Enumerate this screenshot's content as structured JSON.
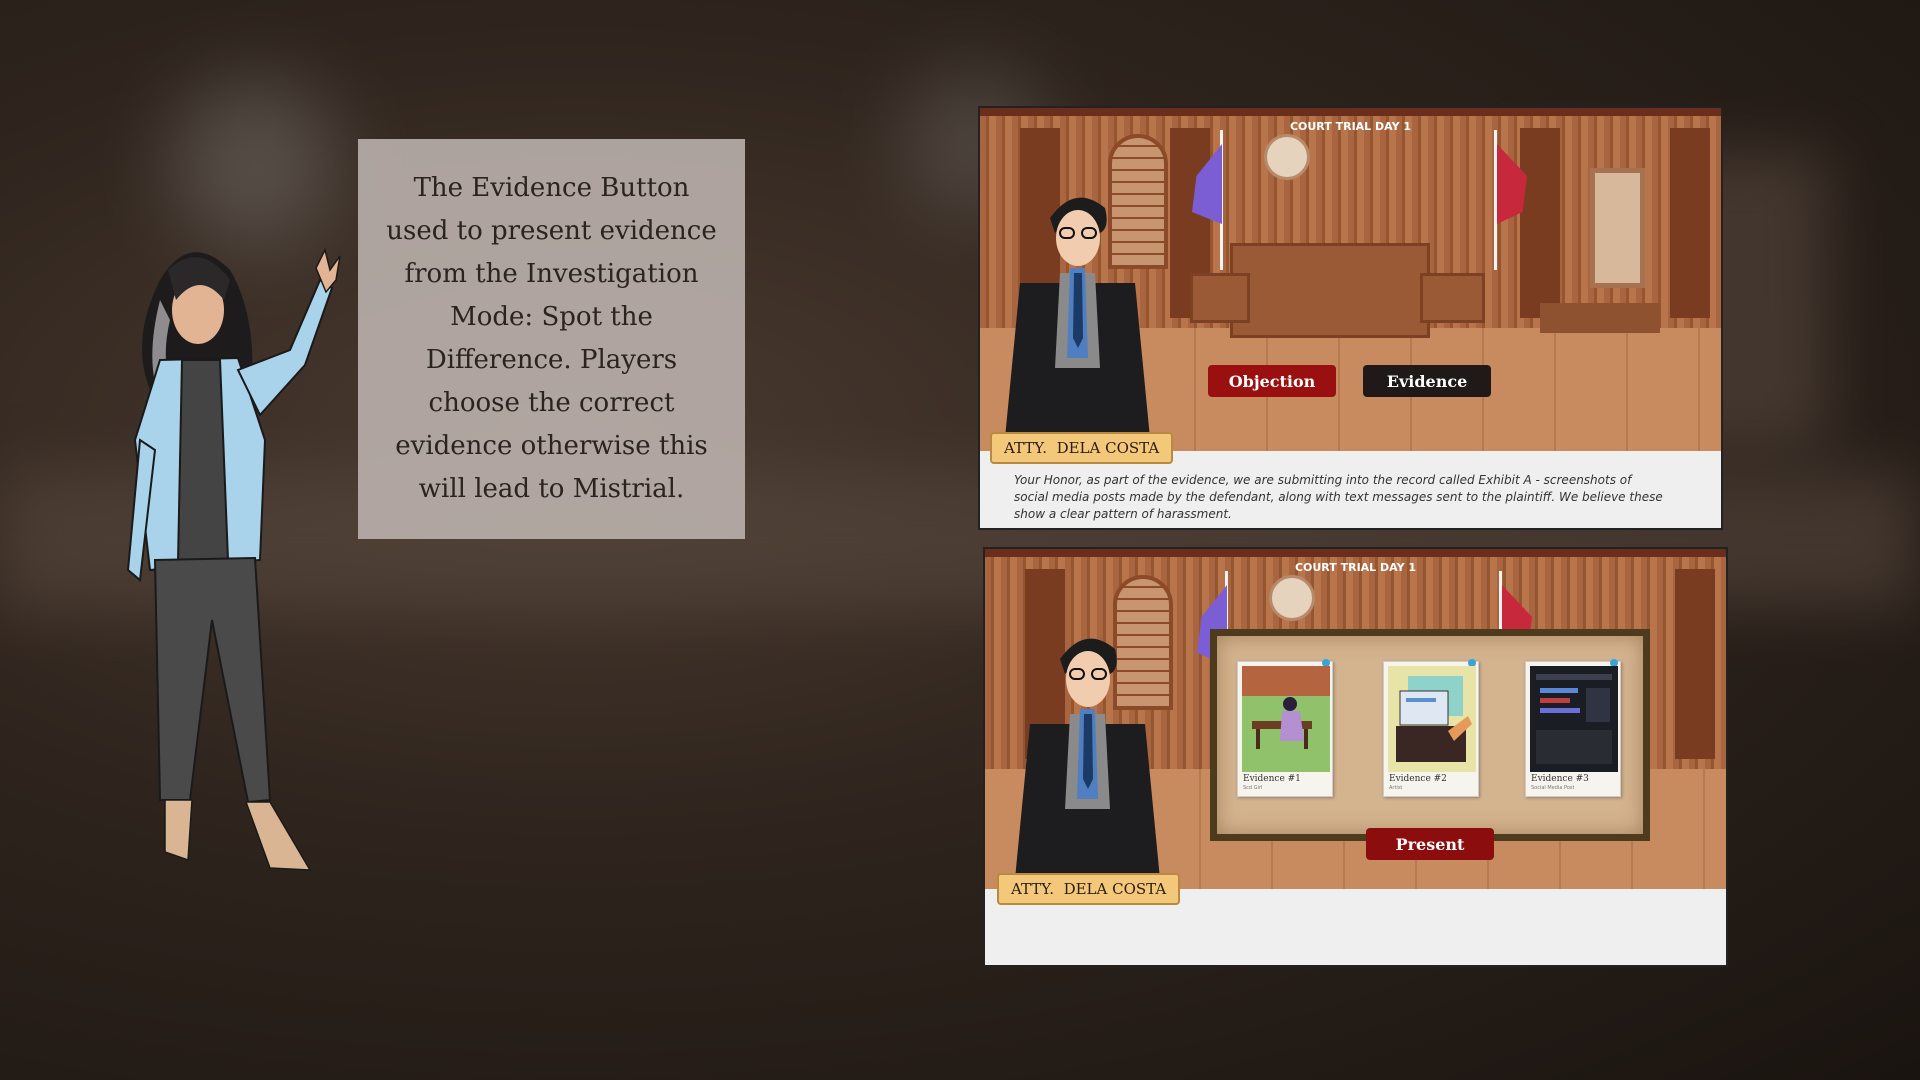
{
  "info_card": {
    "text": "The Evidence Button used to present evidence from the Investigation Mode: Spot the Difference. Players choose the correct evidence otherwise this will lead to Mistrial."
  },
  "screen_top": {
    "title": "COURT TRIAL DAY 1",
    "objection_label": "Objection",
    "evidence_label": "Evidence",
    "speaker": "ATTY.  DELA COSTA",
    "dialogue": "Your Honor, as part of the evidence, we are submitting into the record called Exhibit A - screenshots of social media posts made by the defendant, along with text messages sent to the plaintiff. We believe these show a clear pattern of harassment."
  },
  "screen_bottom": {
    "title": "COURT TRIAL DAY 1",
    "speaker": "ATTY.  DELA COSTA",
    "present_label": "Present",
    "evidence_items": [
      {
        "label": "Evidence #1",
        "sub": "Scd Girl",
        "icon": "girl-on-bench"
      },
      {
        "label": "Evidence #2",
        "sub": "Artist",
        "icon": "computer-screen"
      },
      {
        "label": "Evidence #3",
        "sub": "Social Media Post",
        "icon": "social-media-post"
      }
    ]
  },
  "colors": {
    "objection": "#9a0f0f",
    "evidence": "#1f1a18",
    "present": "#8c0d0d",
    "nameplate": "#f4c87a"
  }
}
